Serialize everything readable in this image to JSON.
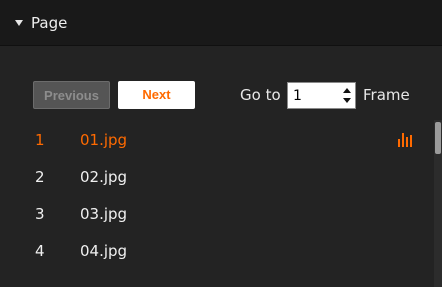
{
  "header": {
    "title": "Page",
    "collapse_icon": "triangle-down-icon"
  },
  "controls": {
    "previous_label": "Previous",
    "next_label": "Next",
    "goto_label": "Go to",
    "goto_value": "1",
    "frame_label": "Frame"
  },
  "frames": [
    {
      "index": "1",
      "name": "01.jpg",
      "selected": true,
      "icon": "bar-chart-icon"
    },
    {
      "index": "2",
      "name": "02.jpg",
      "selected": false
    },
    {
      "index": "3",
      "name": "03.jpg",
      "selected": false
    },
    {
      "index": "4",
      "name": "04.jpg",
      "selected": false
    }
  ],
  "colors": {
    "accent": "#ff6a00",
    "background": "#232323",
    "header_background": "#191919"
  }
}
